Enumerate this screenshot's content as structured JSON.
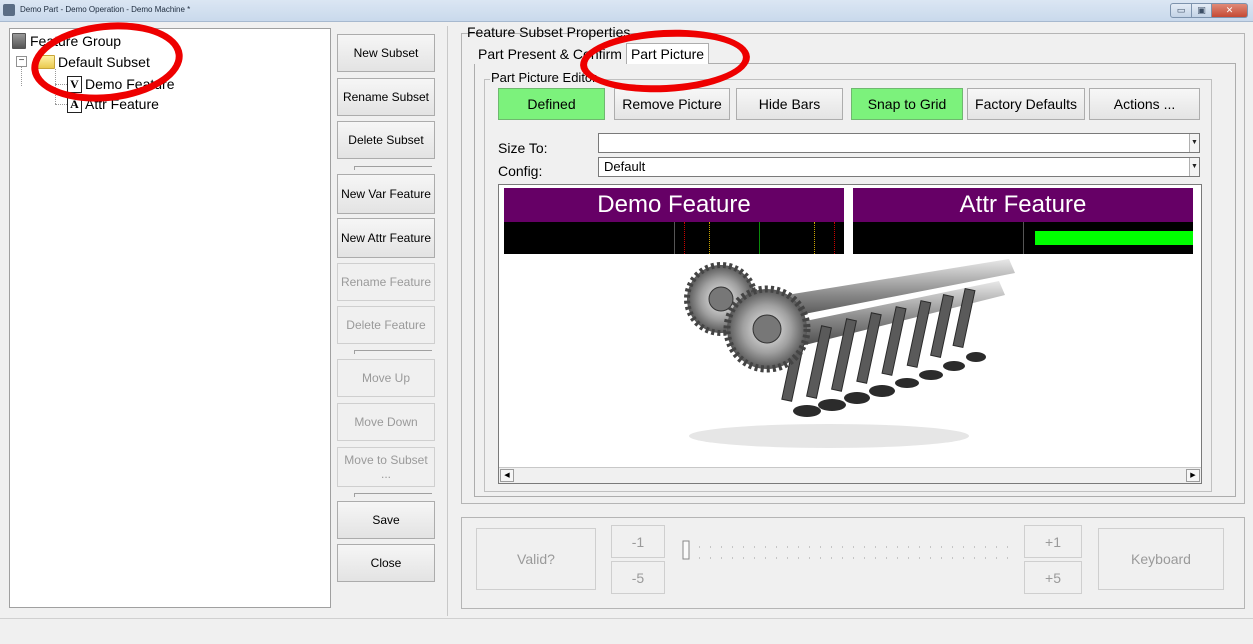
{
  "window": {
    "title": "Demo Part - Demo Operation - Demo Machine *",
    "controls": {
      "minimize": "▭",
      "maximize": "▣",
      "close": "✕"
    }
  },
  "tree": {
    "root": "Feature Group",
    "subset": {
      "label": "Default Subset",
      "expander": "−"
    },
    "features": [
      {
        "label": "Demo Feature",
        "icon_text": "V"
      },
      {
        "label": "Attr Feature",
        "icon_text": "A"
      }
    ]
  },
  "side_buttons": {
    "new_subset": "New Subset",
    "rename_subset": "Rename Subset",
    "delete_subset": "Delete Subset",
    "new_var_feature": "New Var Feature",
    "new_attr_feature": "New Attr Feature",
    "rename_feature": "Rename Feature",
    "delete_feature": "Delete Feature",
    "move_up": "Move Up",
    "move_down": "Move Down",
    "move_to_subset": "Move to Subset ...",
    "save": "Save",
    "close": "Close"
  },
  "properties": {
    "group_label": "Feature Subset Properties",
    "tabs": [
      "Part Present & Confirm",
      "Part Picture"
    ],
    "active_tab": "Part Picture",
    "editor_label": "Part Picture Editor",
    "toolbar": {
      "defined": "Defined",
      "remove_picture": "Remove Picture",
      "hide_bars": "Hide Bars",
      "snap_to_grid": "Snap to Grid",
      "factory_defaults": "Factory Defaults",
      "actions": "Actions ..."
    },
    "size_to": {
      "label": "Size To:",
      "value": ""
    },
    "config": {
      "label": "Config:",
      "value": "Default"
    }
  },
  "picture": {
    "bars": [
      {
        "title": "Demo Feature"
      },
      {
        "title": "Attr Feature",
        "fill_fraction": 0.9
      }
    ],
    "colors": {
      "bar_title": "#660066",
      "fill": "#00ff00",
      "green_toggle": "#7cf27c"
    }
  },
  "bottom": {
    "valid": "Valid?",
    "minus_one": "-1",
    "minus_five": "-5",
    "plus_one": "+1",
    "plus_five": "+5",
    "keyboard": "Keyboard"
  }
}
